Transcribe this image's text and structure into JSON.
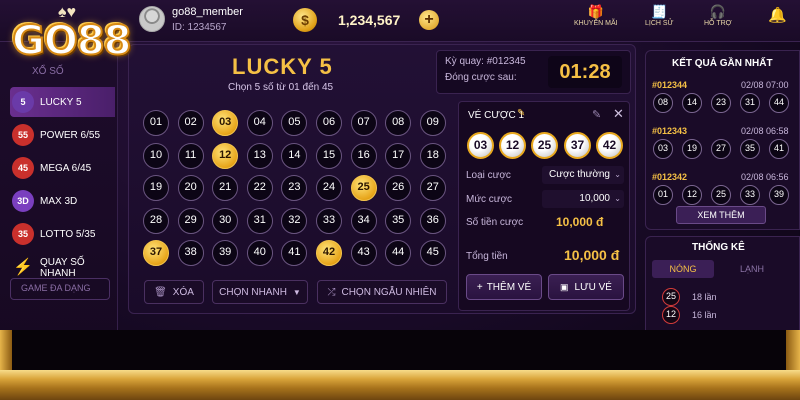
{
  "brand": {
    "logo_text": "GO88",
    "logo_cards": "♠♥"
  },
  "header": {
    "username": "go88_member",
    "user_id": "ID: 1234567",
    "balance": "1,234,567",
    "coin_symbol": "$",
    "plus": "+",
    "nav": [
      {
        "label": "KHUYẾN MÃI",
        "icon": "gift-icon",
        "glyph": "🎁"
      },
      {
        "label": "LỊCH SỬ",
        "icon": "history-icon",
        "glyph": "🧾"
      },
      {
        "label": "HỖ TRỢ",
        "icon": "support-icon",
        "glyph": "🎧"
      }
    ],
    "bell": "🔔"
  },
  "sidebar": {
    "section_label": "XỔ SỐ",
    "items": [
      {
        "label": "LUCKY 5",
        "badge": "5",
        "color": "#6a3aa8",
        "active": true
      },
      {
        "label": "POWER 6/55",
        "badge": "55",
        "color": "#c9302c"
      },
      {
        "label": "MEGA 6/45",
        "badge": "45",
        "color": "#c9302c"
      },
      {
        "label": "MAX 3D",
        "badge": "3D",
        "color": "#7a3fbf"
      },
      {
        "label": "LOTTO 5/35",
        "badge": "35",
        "color": "#c9302c"
      },
      {
        "label": "QUAY SỐ NHANH",
        "badge": "⚡",
        "color": "#e7a51a"
      }
    ],
    "footer": "GAME ĐA DẠNG"
  },
  "game": {
    "title": "LUCKY 5",
    "subtitle": "Chọn 5 số từ 01 đến 45",
    "draw_label": "Kỳ quay: #012345",
    "close_label": "Đóng cược sau:",
    "timer": "01:28",
    "numbers": [
      "01",
      "02",
      "03",
      "04",
      "05",
      "06",
      "07",
      "08",
      "09",
      "10",
      "11",
      "12",
      "13",
      "14",
      "15",
      "16",
      "17",
      "18",
      "19",
      "20",
      "21",
      "22",
      "23",
      "24",
      "25",
      "26",
      "27",
      "28",
      "29",
      "30",
      "31",
      "32",
      "33",
      "34",
      "35",
      "36",
      "37",
      "38",
      "39",
      "40",
      "41",
      "42",
      "43",
      "44",
      "45"
    ],
    "selected": [
      "03",
      "12",
      "25",
      "37",
      "42"
    ],
    "clear_label": "XÓA",
    "quick_label": "CHỌN NHANH",
    "random_label": "CHỌN NGẪU NHIÊN"
  },
  "ticket": {
    "title": "VÉ CƯỢC 1",
    "balls": [
      "03",
      "12",
      "25",
      "37",
      "42"
    ],
    "type_label": "Loại cược",
    "type_value": "Cược thường",
    "level_label": "Mức cược",
    "level_value": "10,000",
    "amount_label": "Số tiền cược",
    "amount_value": "10,000 đ",
    "total_label": "Tổng tiền",
    "total_value": "10,000 đ",
    "add_label": "THÊM VÉ",
    "save_label": "LƯU VÉ"
  },
  "results": {
    "title": "KẾT QUẢ GẦN NHẤT",
    "rows": [
      {
        "id": "#012344",
        "time": "02/08 07:00",
        "balls": [
          "08",
          "14",
          "23",
          "31",
          "44"
        ]
      },
      {
        "id": "#012343",
        "time": "02/08 06:58",
        "balls": [
          "03",
          "19",
          "27",
          "35",
          "41"
        ]
      },
      {
        "id": "#012342",
        "time": "02/08 06:56",
        "balls": [
          "01",
          "12",
          "25",
          "33",
          "39"
        ]
      }
    ],
    "more_label": "XEM THÊM"
  },
  "stats": {
    "title": "THỐNG KÊ",
    "tab_hot": "NÓNG",
    "tab_cold": "LẠNH",
    "rows": [
      {
        "num": "25",
        "text": "18 lần"
      },
      {
        "num": "12",
        "text": "16 lần"
      }
    ]
  }
}
